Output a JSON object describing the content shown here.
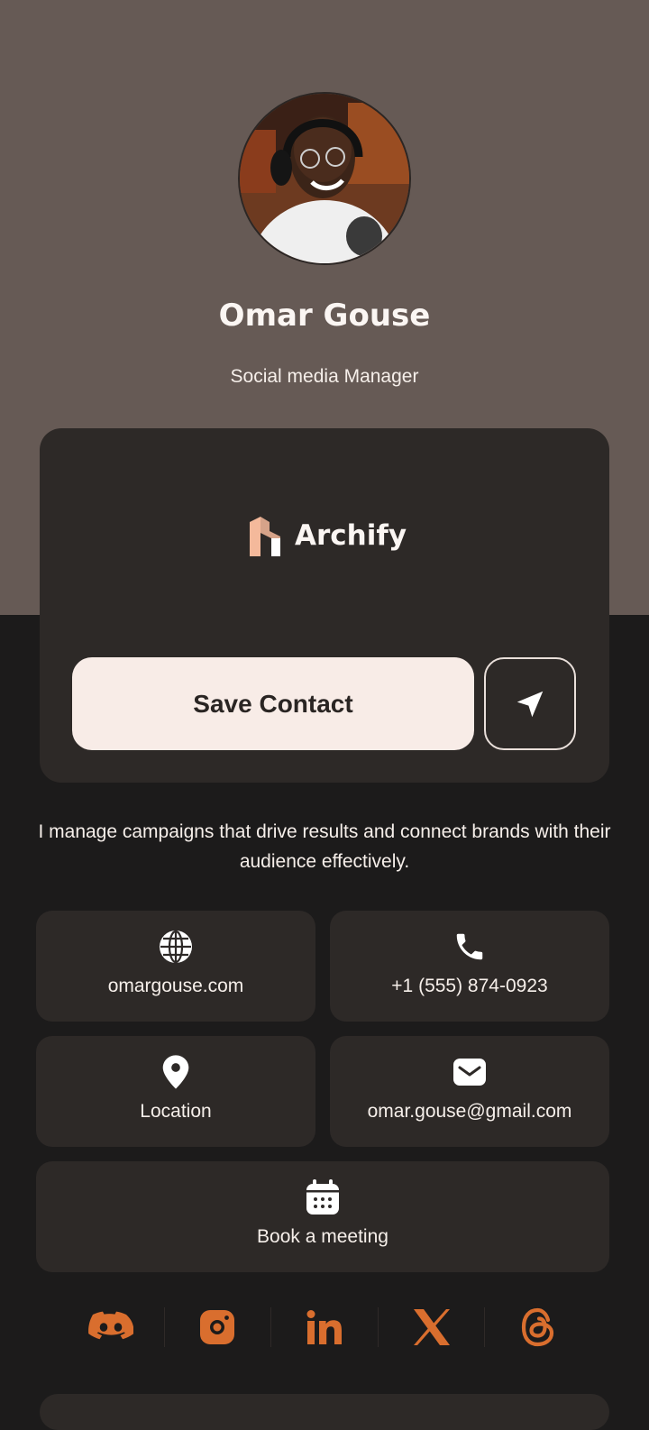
{
  "profile": {
    "name": "Omar Gouse",
    "role": "Social media Manager"
  },
  "company": {
    "name": "Archify",
    "logo_icon": "archify-logo-icon"
  },
  "actions": {
    "save_label": "Save Contact",
    "share_icon": "send-icon"
  },
  "bio": "I manage campaigns that drive results and connect brands with their audience effectively.",
  "contacts": {
    "website": "omargouse.com",
    "phone": "+1 (555) 874-0923",
    "location": "Location",
    "email": "omar.gouse@gmail.com",
    "meeting": "Book a meeting"
  },
  "socials": [
    "discord-icon",
    "instagram-icon",
    "linkedin-icon",
    "x-icon",
    "threads-icon"
  ],
  "colors": {
    "header_bg": "#665a55",
    "page_bg": "#1c1b1b",
    "card_bg": "#2d2927",
    "accent": "#d96e2e",
    "brand_peach": "#f4b99b",
    "button_bg": "#f8ece7"
  }
}
